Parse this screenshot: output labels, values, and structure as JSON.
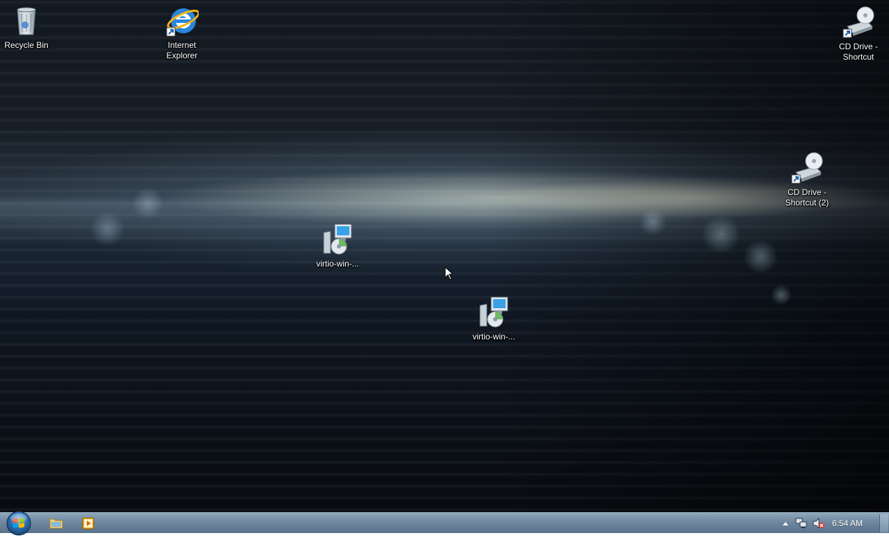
{
  "desktop": {
    "icons": [
      {
        "id": "recycle-bin",
        "label": "Recycle Bin",
        "icon": "recycle-bin-icon"
      },
      {
        "id": "internet-explorer",
        "label": "Internet Explorer",
        "icon": "internet-explorer-icon"
      },
      {
        "id": "cd-drive-shortcut",
        "label": "CD Drive - Shortcut",
        "icon": "cd-drive-shortcut-icon"
      },
      {
        "id": "cd-drive-shortcut-2",
        "label": "CD Drive - Shortcut (2)",
        "icon": "cd-drive-shortcut-icon"
      },
      {
        "id": "virtio-win-1",
        "label": "virtio-win-...",
        "icon": "installer-icon"
      },
      {
        "id": "virtio-win-2",
        "label": "virtio-win-...",
        "icon": "installer-icon"
      }
    ]
  },
  "taskbar": {
    "pinned": [
      {
        "id": "windows-explorer",
        "icon": "folder-icon"
      },
      {
        "id": "media-player",
        "icon": "media-player-icon"
      }
    ],
    "tray": {
      "icons": [
        "show-hidden-icons-arrow",
        "network-icon",
        "volume-muted-icon"
      ],
      "clock": "6:54 AM"
    }
  },
  "colors": {
    "taskbar": "#6f88a0",
    "label_text": "#ffffff"
  }
}
